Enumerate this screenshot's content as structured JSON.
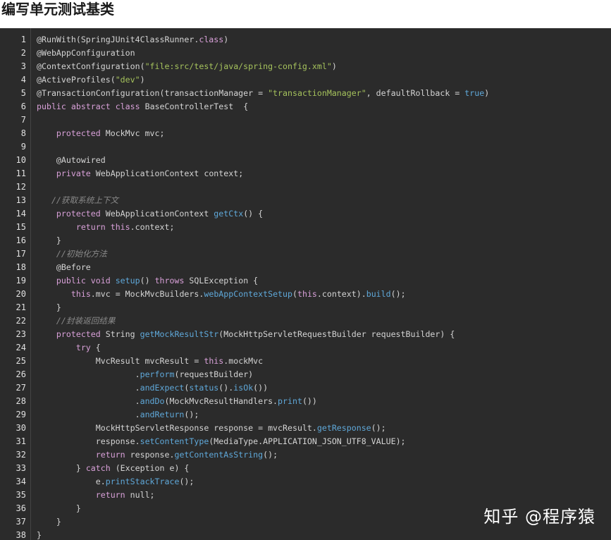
{
  "heading": "编写单元测试基类",
  "watermark": "知乎 @程序猿",
  "colors": {
    "code_background": "#2b2b2b",
    "keyword": "#d8a0d8",
    "string": "#a5c25c",
    "comment": "#8a8a8a",
    "method": "#5fa8d9",
    "plain": "#d4d4d4"
  },
  "code": {
    "language": "java",
    "lines": [
      {
        "num": "1",
        "tokens": [
          {
            "t": "@RunWith(SpringJUnit4ClassRunner.",
            "k": "annotation"
          },
          {
            "t": "class",
            "k": "keyword"
          },
          {
            "t": ")",
            "k": "punct"
          }
        ]
      },
      {
        "num": "2",
        "tokens": [
          {
            "t": "@WebAppConfiguration",
            "k": "annotation"
          }
        ]
      },
      {
        "num": "3",
        "tokens": [
          {
            "t": "@ContextConfiguration(",
            "k": "annotation"
          },
          {
            "t": "\"file:src/test/java/spring-config.xml\"",
            "k": "string"
          },
          {
            "t": ")",
            "k": "punct"
          }
        ]
      },
      {
        "num": "4",
        "tokens": [
          {
            "t": "@ActiveProfiles(",
            "k": "annotation"
          },
          {
            "t": "\"dev\"",
            "k": "string"
          },
          {
            "t": ")",
            "k": "punct"
          }
        ]
      },
      {
        "num": "5",
        "tokens": [
          {
            "t": "@TransactionConfiguration(transactionManager ",
            "k": "annotation"
          },
          {
            "t": "=",
            "k": "operator"
          },
          {
            "t": " ",
            "k": "plain"
          },
          {
            "t": "\"transactionManager\"",
            "k": "string"
          },
          {
            "t": ", defaultRollback ",
            "k": "plain"
          },
          {
            "t": "=",
            "k": "operator"
          },
          {
            "t": " ",
            "k": "plain"
          },
          {
            "t": "true",
            "k": "literal"
          },
          {
            "t": ")",
            "k": "punct"
          }
        ]
      },
      {
        "num": "6",
        "tokens": [
          {
            "t": "public",
            "k": "keyword"
          },
          {
            "t": " ",
            "k": "plain"
          },
          {
            "t": "abstract",
            "k": "keyword"
          },
          {
            "t": " ",
            "k": "plain"
          },
          {
            "t": "class",
            "k": "keyword"
          },
          {
            "t": " BaseControllerTest  {",
            "k": "plain"
          }
        ]
      },
      {
        "num": "7",
        "tokens": []
      },
      {
        "num": "8",
        "tokens": [
          {
            "t": "    ",
            "k": "plain"
          },
          {
            "t": "protected",
            "k": "keyword"
          },
          {
            "t": " MockMvc mvc;",
            "k": "plain"
          }
        ]
      },
      {
        "num": "9",
        "tokens": []
      },
      {
        "num": "10",
        "tokens": [
          {
            "t": "    @Autowired",
            "k": "annotation"
          }
        ]
      },
      {
        "num": "11",
        "tokens": [
          {
            "t": "    ",
            "k": "plain"
          },
          {
            "t": "private",
            "k": "keyword"
          },
          {
            "t": " WebApplicationContext context;",
            "k": "plain"
          }
        ]
      },
      {
        "num": "12",
        "tokens": []
      },
      {
        "num": "13",
        "tokens": [
          {
            "t": "   //获取系统上下文",
            "k": "comment"
          }
        ]
      },
      {
        "num": "14",
        "tokens": [
          {
            "t": "    ",
            "k": "plain"
          },
          {
            "t": "protected",
            "k": "keyword"
          },
          {
            "t": " WebApplicationContext ",
            "k": "plain"
          },
          {
            "t": "getCtx",
            "k": "method"
          },
          {
            "t": "() {",
            "k": "punct"
          }
        ]
      },
      {
        "num": "15",
        "tokens": [
          {
            "t": "        ",
            "k": "plain"
          },
          {
            "t": "return",
            "k": "keyword"
          },
          {
            "t": " ",
            "k": "plain"
          },
          {
            "t": "this",
            "k": "keyword"
          },
          {
            "t": ".context;",
            "k": "plain"
          }
        ]
      },
      {
        "num": "16",
        "tokens": [
          {
            "t": "    }",
            "k": "punct"
          }
        ]
      },
      {
        "num": "17",
        "tokens": [
          {
            "t": "    //初始化方法",
            "k": "comment"
          }
        ]
      },
      {
        "num": "18",
        "tokens": [
          {
            "t": "    @Before",
            "k": "annotation"
          }
        ]
      },
      {
        "num": "19",
        "tokens": [
          {
            "t": "    ",
            "k": "plain"
          },
          {
            "t": "public",
            "k": "keyword"
          },
          {
            "t": " ",
            "k": "plain"
          },
          {
            "t": "void",
            "k": "keyword"
          },
          {
            "t": " ",
            "k": "plain"
          },
          {
            "t": "setup",
            "k": "method"
          },
          {
            "t": "() ",
            "k": "punct"
          },
          {
            "t": "throws",
            "k": "keyword"
          },
          {
            "t": " SQLException {",
            "k": "plain"
          }
        ]
      },
      {
        "num": "20",
        "tokens": [
          {
            "t": "       ",
            "k": "plain"
          },
          {
            "t": "this",
            "k": "keyword"
          },
          {
            "t": ".mvc ",
            "k": "plain"
          },
          {
            "t": "=",
            "k": "operator"
          },
          {
            "t": " MockMvcBuilders.",
            "k": "plain"
          },
          {
            "t": "webAppContextSetup",
            "k": "method"
          },
          {
            "t": "(",
            "k": "punct"
          },
          {
            "t": "this",
            "k": "keyword"
          },
          {
            "t": ".context).",
            "k": "plain"
          },
          {
            "t": "build",
            "k": "method"
          },
          {
            "t": "();",
            "k": "punct"
          }
        ]
      },
      {
        "num": "21",
        "tokens": [
          {
            "t": "    }",
            "k": "punct"
          }
        ]
      },
      {
        "num": "22",
        "tokens": [
          {
            "t": "    //封装返回结果",
            "k": "comment"
          }
        ]
      },
      {
        "num": "23",
        "tokens": [
          {
            "t": "    ",
            "k": "plain"
          },
          {
            "t": "protected",
            "k": "keyword"
          },
          {
            "t": " String ",
            "k": "plain"
          },
          {
            "t": "getMockResultStr",
            "k": "method"
          },
          {
            "t": "(MockHttpServletRequestBuilder requestBuilder) {",
            "k": "plain"
          }
        ]
      },
      {
        "num": "24",
        "tokens": [
          {
            "t": "        ",
            "k": "plain"
          },
          {
            "t": "try",
            "k": "keyword"
          },
          {
            "t": " {",
            "k": "punct"
          }
        ]
      },
      {
        "num": "25",
        "tokens": [
          {
            "t": "            MvcResult mvcResult ",
            "k": "plain"
          },
          {
            "t": "=",
            "k": "operator"
          },
          {
            "t": " ",
            "k": "plain"
          },
          {
            "t": "this",
            "k": "keyword"
          },
          {
            "t": ".mockMvc",
            "k": "plain"
          }
        ]
      },
      {
        "num": "26",
        "tokens": [
          {
            "t": "                    .",
            "k": "plain"
          },
          {
            "t": "perform",
            "k": "method"
          },
          {
            "t": "(requestBuilder)",
            "k": "plain"
          }
        ]
      },
      {
        "num": "27",
        "tokens": [
          {
            "t": "                    .",
            "k": "plain"
          },
          {
            "t": "andExpect",
            "k": "method"
          },
          {
            "t": "(",
            "k": "punct"
          },
          {
            "t": "status",
            "k": "method"
          },
          {
            "t": "().",
            "k": "punct"
          },
          {
            "t": "isOk",
            "k": "method"
          },
          {
            "t": "())",
            "k": "punct"
          }
        ]
      },
      {
        "num": "28",
        "tokens": [
          {
            "t": "                    .",
            "k": "plain"
          },
          {
            "t": "andDo",
            "k": "method"
          },
          {
            "t": "(MockMvcResultHandlers.",
            "k": "plain"
          },
          {
            "t": "print",
            "k": "method"
          },
          {
            "t": "())",
            "k": "punct"
          }
        ]
      },
      {
        "num": "29",
        "tokens": [
          {
            "t": "                    .",
            "k": "plain"
          },
          {
            "t": "andReturn",
            "k": "method"
          },
          {
            "t": "();",
            "k": "punct"
          }
        ]
      },
      {
        "num": "30",
        "tokens": [
          {
            "t": "            MockHttpServletResponse response ",
            "k": "plain"
          },
          {
            "t": "=",
            "k": "operator"
          },
          {
            "t": " mvcResult.",
            "k": "plain"
          },
          {
            "t": "getResponse",
            "k": "method"
          },
          {
            "t": "();",
            "k": "punct"
          }
        ]
      },
      {
        "num": "31",
        "tokens": [
          {
            "t": "            response.",
            "k": "plain"
          },
          {
            "t": "setContentType",
            "k": "method"
          },
          {
            "t": "(MediaType.APPLICATION_JSON_UTF8_VALUE);",
            "k": "plain"
          }
        ]
      },
      {
        "num": "32",
        "tokens": [
          {
            "t": "            ",
            "k": "plain"
          },
          {
            "t": "return",
            "k": "keyword"
          },
          {
            "t": " response.",
            "k": "plain"
          },
          {
            "t": "getContentAsString",
            "k": "method"
          },
          {
            "t": "();",
            "k": "punct"
          }
        ]
      },
      {
        "num": "33",
        "tokens": [
          {
            "t": "        } ",
            "k": "punct"
          },
          {
            "t": "catch",
            "k": "keyword"
          },
          {
            "t": " (Exception e) {",
            "k": "plain"
          }
        ]
      },
      {
        "num": "34",
        "tokens": [
          {
            "t": "            e.",
            "k": "plain"
          },
          {
            "t": "printStackTrace",
            "k": "method"
          },
          {
            "t": "();",
            "k": "punct"
          }
        ]
      },
      {
        "num": "35",
        "tokens": [
          {
            "t": "            ",
            "k": "plain"
          },
          {
            "t": "return",
            "k": "keyword"
          },
          {
            "t": " null;",
            "k": "plain"
          }
        ]
      },
      {
        "num": "36",
        "tokens": [
          {
            "t": "        }",
            "k": "punct"
          }
        ]
      },
      {
        "num": "37",
        "tokens": [
          {
            "t": "    }",
            "k": "punct"
          }
        ]
      },
      {
        "num": "38",
        "tokens": [
          {
            "t": "}",
            "k": "punct"
          }
        ]
      }
    ]
  }
}
